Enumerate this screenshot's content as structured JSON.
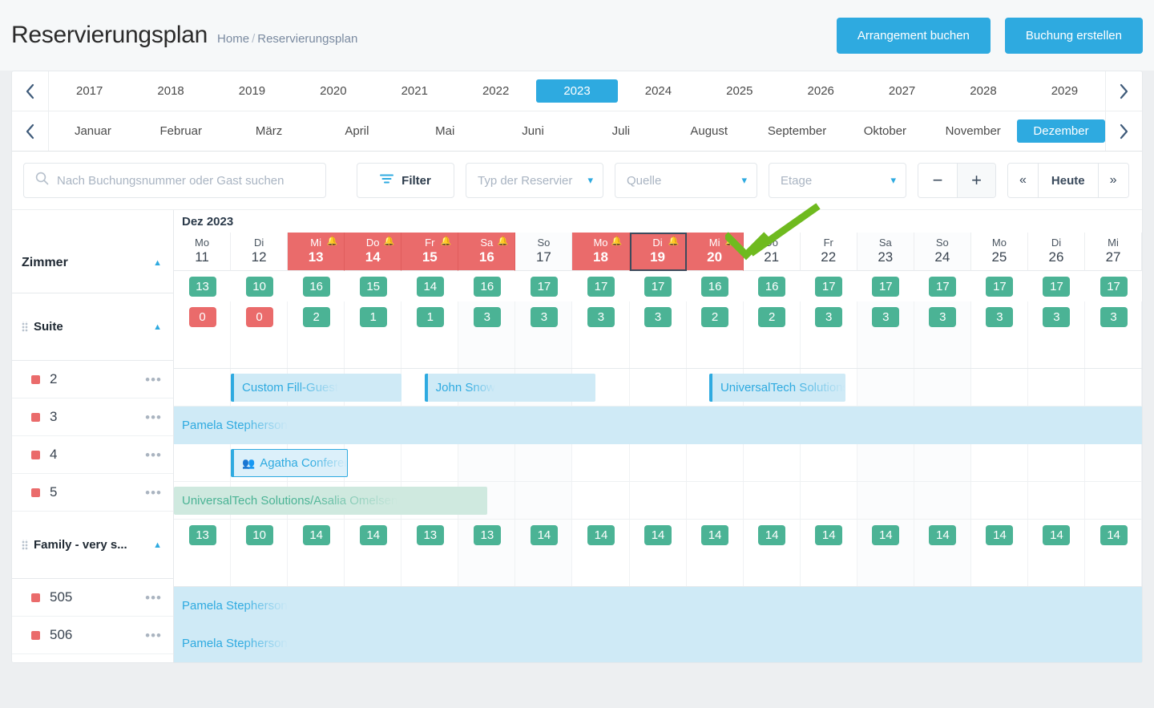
{
  "header": {
    "title": "Reservierungsplan",
    "breadcrumb_home": "Home",
    "breadcrumb_sep": "/",
    "breadcrumb_current": "Reservierungsplan",
    "btn_arrangement": "Arrangement buchen",
    "btn_booking": "Buchung erstellen",
    "accent_color": "#2eaae0"
  },
  "years": {
    "items": [
      "2017",
      "2018",
      "2019",
      "2020",
      "2021",
      "2022",
      "2023",
      "2024",
      "2025",
      "2026",
      "2027",
      "2028",
      "2029"
    ],
    "active": "2023"
  },
  "months": {
    "items": [
      "Januar",
      "Februar",
      "März",
      "April",
      "Mai",
      "Juni",
      "Juli",
      "August",
      "September",
      "Oktober",
      "November",
      "Dezember"
    ],
    "active": "Dezember"
  },
  "toolbar": {
    "search_placeholder": "Nach Buchungsnummer oder Gast suchen",
    "filter_label": "Filter",
    "select_typ": "Typ der Reservier",
    "select_quelle": "Quelle",
    "select_etage": "Etage",
    "zoom_out": "−",
    "zoom_in": "+",
    "prev": "«",
    "today": "Heute",
    "next": "»"
  },
  "calendar": {
    "month_label": "Dez 2023",
    "group_label": "Zimmer",
    "days": [
      {
        "dow": "Mo",
        "num": "11",
        "red": false,
        "weekend": false,
        "today": false,
        "bell": false
      },
      {
        "dow": "Di",
        "num": "12",
        "red": false,
        "weekend": false,
        "today": false,
        "bell": false
      },
      {
        "dow": "Mi",
        "num": "13",
        "red": true,
        "weekend": false,
        "today": false,
        "bell": true
      },
      {
        "dow": "Do",
        "num": "14",
        "red": true,
        "weekend": false,
        "today": false,
        "bell": true
      },
      {
        "dow": "Fr",
        "num": "15",
        "red": true,
        "weekend": false,
        "today": false,
        "bell": true
      },
      {
        "dow": "Sa",
        "num": "16",
        "red": true,
        "weekend": true,
        "today": false,
        "bell": true
      },
      {
        "dow": "So",
        "num": "17",
        "red": false,
        "weekend": true,
        "today": false,
        "bell": false
      },
      {
        "dow": "Mo",
        "num": "18",
        "red": true,
        "weekend": false,
        "today": false,
        "bell": true
      },
      {
        "dow": "Di",
        "num": "19",
        "red": true,
        "weekend": false,
        "today": true,
        "bell": true
      },
      {
        "dow": "Mi",
        "num": "20",
        "red": true,
        "weekend": false,
        "today": false,
        "bell": true
      },
      {
        "dow": "Do",
        "num": "21",
        "red": false,
        "weekend": false,
        "today": false,
        "bell": false
      },
      {
        "dow": "Fr",
        "num": "22",
        "red": false,
        "weekend": false,
        "today": false,
        "bell": false
      },
      {
        "dow": "Sa",
        "num": "23",
        "red": false,
        "weekend": true,
        "today": false,
        "bell": false
      },
      {
        "dow": "So",
        "num": "24",
        "red": false,
        "weekend": true,
        "today": false,
        "bell": false
      },
      {
        "dow": "Mo",
        "num": "25",
        "red": false,
        "weekend": false,
        "today": false,
        "bell": false
      },
      {
        "dow": "Di",
        "num": "26",
        "red": false,
        "weekend": false,
        "today": false,
        "bell": false
      },
      {
        "dow": "Mi",
        "num": "27",
        "red": false,
        "weekend": false,
        "today": false,
        "bell": false
      }
    ],
    "availability_total": [
      "13",
      "10",
      "16",
      "15",
      "14",
      "16",
      "17",
      "17",
      "17",
      "16",
      "16",
      "17",
      "17",
      "17",
      "17",
      "17",
      "17"
    ],
    "groups": [
      {
        "label": "Suite",
        "availability": [
          "0",
          "0",
          "2",
          "1",
          "1",
          "3",
          "3",
          "3",
          "3",
          "2",
          "2",
          "3",
          "3",
          "3",
          "3",
          "3",
          "3"
        ],
        "rooms": [
          {
            "number": "2",
            "bars": [
              {
                "text": "Custom Fill-Guest",
                "style": "blue",
                "start": 1,
                "span": 3,
                "icon": null
              },
              {
                "text": "John Snow",
                "style": "blue",
                "start": 4.4,
                "span": 3,
                "icon": null
              },
              {
                "text": "UniversalTech Solutions",
                "style": "blue",
                "start": 9.4,
                "span": 2.4,
                "icon": null
              }
            ]
          },
          {
            "number": "3",
            "bars": [
              {
                "text": "Pamela Stepherson",
                "style": "full",
                "start": 0,
                "span": 17,
                "icon": null
              }
            ]
          },
          {
            "number": "4",
            "bars": [
              {
                "text": "Agatha Conference",
                "style": "blue-outline",
                "start": 1,
                "span": 2.05,
                "icon": "guests-icon"
              }
            ]
          },
          {
            "number": "5",
            "bars": [
              {
                "text": "UniversalTech Solutions/Asalia Omelsen",
                "style": "green",
                "start": 0,
                "span": 5.5,
                "icon": null
              }
            ]
          }
        ]
      },
      {
        "label": "Family - very s...",
        "availability": [
          "13",
          "10",
          "14",
          "14",
          "13",
          "13",
          "14",
          "14",
          "14",
          "14",
          "14",
          "14",
          "14",
          "14",
          "14",
          "14",
          "14"
        ],
        "rooms": [
          {
            "number": "505",
            "bars": [
              {
                "text": "Pamela Stepherson",
                "style": "full",
                "start": 0,
                "span": 17,
                "icon": null
              }
            ]
          },
          {
            "number": "506",
            "bars": [
              {
                "text": "Pamela Stepherson",
                "style": "full",
                "start": 0,
                "span": 17,
                "icon": null
              }
            ]
          }
        ]
      }
    ]
  },
  "annotation": {
    "arrow_color": "#6fba1f"
  }
}
